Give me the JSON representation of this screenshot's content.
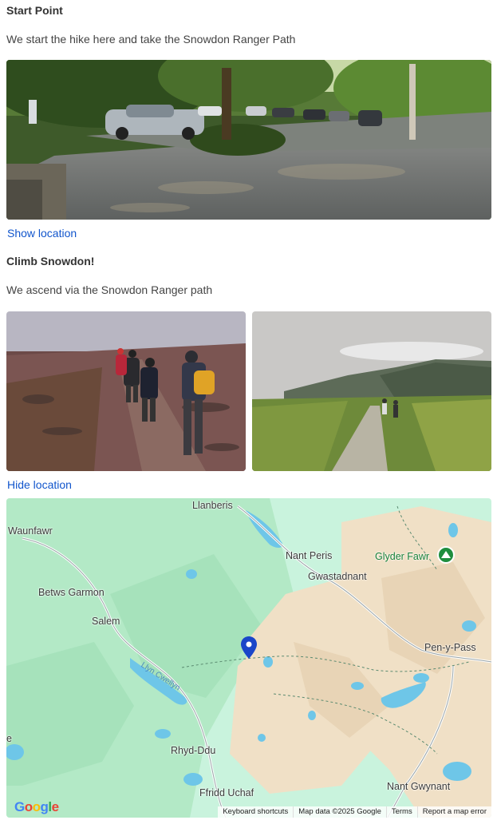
{
  "section1": {
    "title": "Start Point",
    "description": "We start the hike here and take the Snowdon Ranger Path",
    "location_link": "Show location"
  },
  "section2": {
    "title": "Climb Snowdon!",
    "description": "We ascend via the Snowdon Ranger path",
    "location_link": "Hide location"
  },
  "map": {
    "places": {
      "llanberis": "Llanberis",
      "waunfawr": "Waunfawr",
      "nant_peris": "Nant Peris",
      "glyder_fawr": "Glyder Fawr",
      "gwastadnant": "Gwastadnant",
      "betws_garmon": "Betws Garmon",
      "salem": "Salem",
      "pen_y_pass": "Pen-y-Pass",
      "llyn_cwellyn": "Llyn Cwellyn",
      "e": "e",
      "rhyd_ddu": "Rhyd-Ddu",
      "ffridd_uchaf": "Ffridd Uchaf",
      "nant_gwynant": "Nant Gwynant"
    },
    "logo": "Google",
    "attribution": {
      "shortcuts": "Keyboard shortcuts",
      "data": "Map data ©2025 Google",
      "terms": "Terms",
      "report": "Report a map error"
    }
  }
}
